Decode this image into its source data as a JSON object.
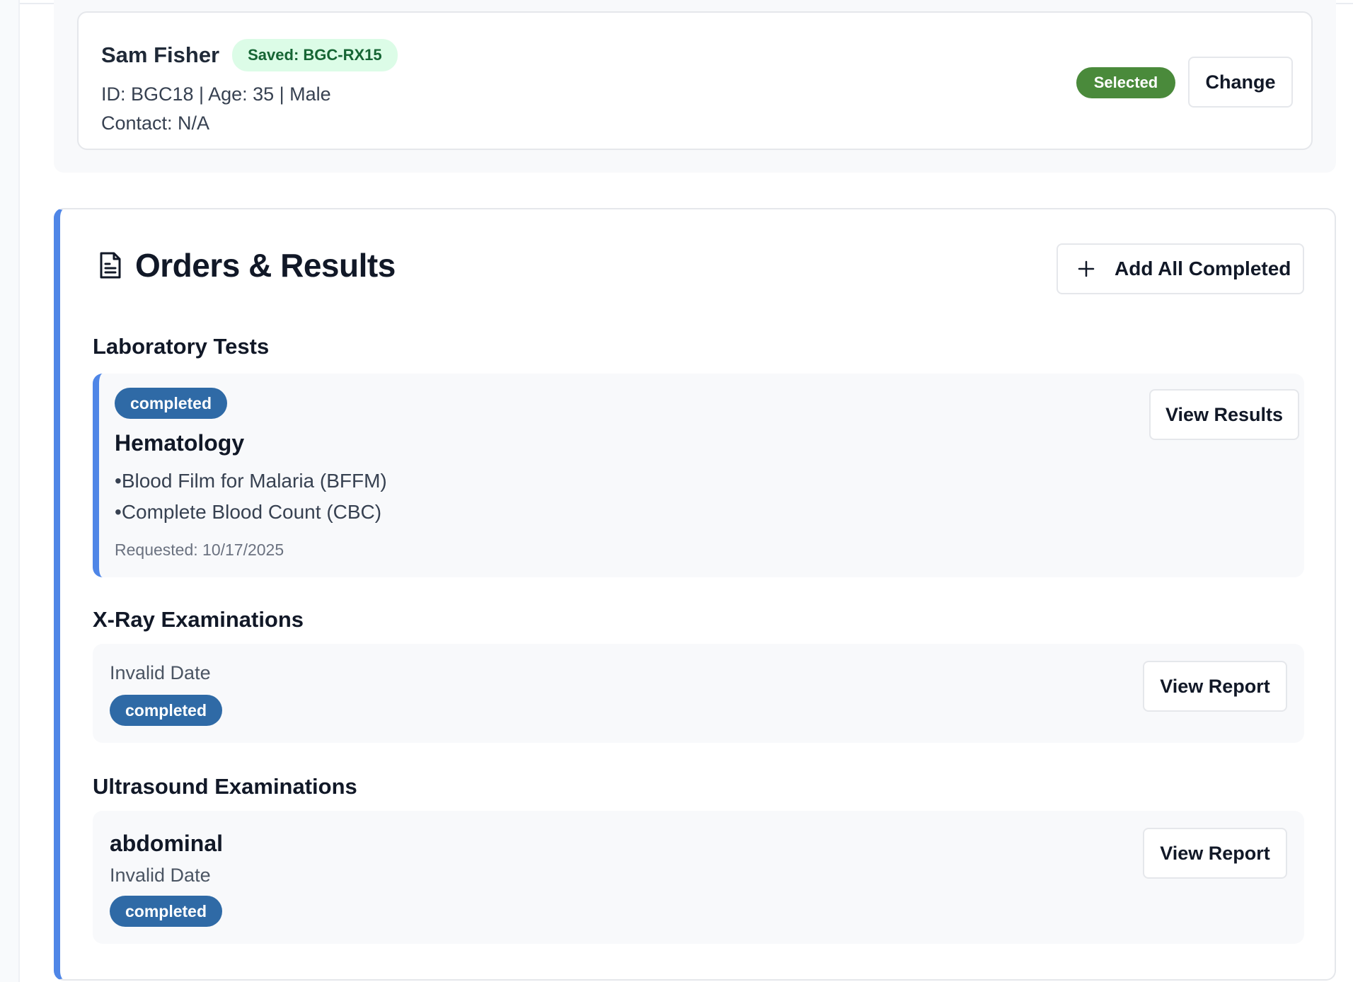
{
  "patient": {
    "name": "Sam Fisher",
    "saved_badge": "Saved: BGC-RX15",
    "meta": "ID: BGC18 | Age: 35 | Male",
    "contact": "Contact: N/A",
    "selected_badge": "Selected",
    "change_label": "Change"
  },
  "orders": {
    "title": "Orders & Results",
    "icon": "document-icon",
    "add_all_label": "Add All Completed",
    "add_all_icon": "plus-icon",
    "lab": {
      "heading": "Laboratory Tests",
      "status": "completed",
      "name": "Hematology",
      "tests": [
        "Blood Film for Malaria (BFFM)",
        "Complete Blood Count (CBC)"
      ],
      "requested": "Requested: 10/17/2025",
      "view_label": "View Results"
    },
    "xray": {
      "heading": "X-Ray Examinations",
      "date": "Invalid Date",
      "status": "completed",
      "view_label": "View Report"
    },
    "ultrasound": {
      "heading": "Ultrasound Examinations",
      "name": "abdominal",
      "date": "Invalid Date",
      "status": "completed",
      "view_label": "View Report"
    }
  },
  "colors": {
    "accent_blue": "#4f86e7",
    "status_completed": "#2f6aa6",
    "selected_green": "#4a8a3b",
    "saved_badge_bg": "#dcfce7",
    "saved_badge_text": "#166534"
  }
}
